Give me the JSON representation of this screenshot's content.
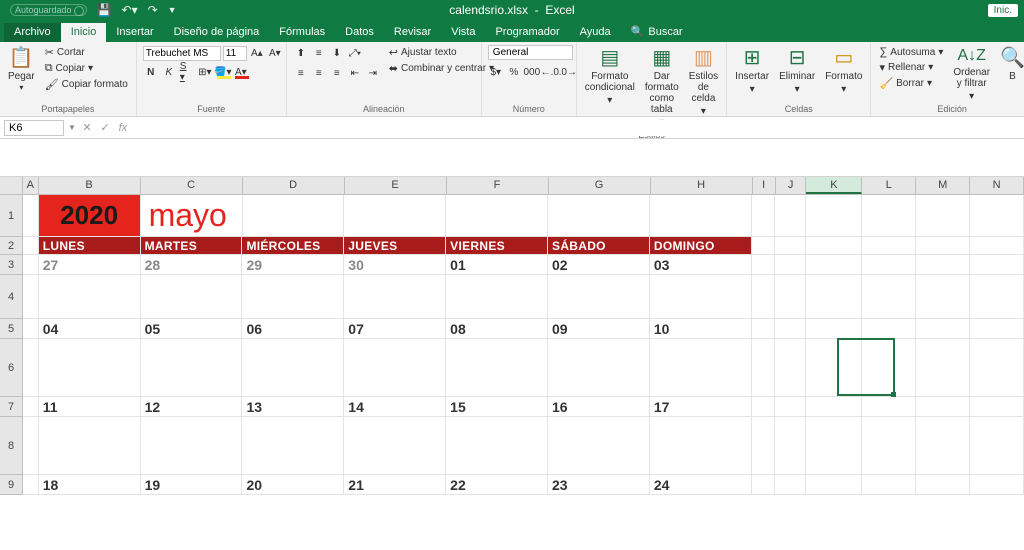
{
  "titlebar": {
    "autosave": "Autoguardado",
    "filename": "calendsrio.xlsx",
    "app": "Excel",
    "signin": "Inic."
  },
  "tabs": {
    "file": "Archivo",
    "home": "Inicio",
    "insert": "Insertar",
    "layout": "Diseño de página",
    "formulas": "Fórmulas",
    "data": "Datos",
    "review": "Revisar",
    "view": "Vista",
    "dev": "Programador",
    "help": "Ayuda",
    "tell": "Buscar"
  },
  "ribbon": {
    "clipboard": {
      "label": "Portapapeles",
      "paste": "Pegar",
      "cut": "Cortar",
      "copy": "Copiar",
      "format": "Copiar formato"
    },
    "font": {
      "label": "Fuente",
      "name": "Trebuchet MS",
      "size": "11"
    },
    "align": {
      "label": "Alineación",
      "wrap": "Ajustar texto",
      "merge": "Combinar y centrar"
    },
    "number": {
      "label": "Número",
      "format": "General"
    },
    "styles": {
      "label": "Estilos",
      "cond": "Formato condicional",
      "table": "Dar formato como tabla",
      "cell": "Estilos de celda"
    },
    "cells": {
      "label": "Celdas",
      "insert": "Insertar",
      "delete": "Eliminar",
      "format": "Formato"
    },
    "editing": {
      "label": "Edición",
      "sum": "Autosuma",
      "fill": "Rellenar",
      "clear": "Borrar",
      "sort": "Ordenar y filtrar",
      "find": "B"
    }
  },
  "namebox": "K6",
  "columns": [
    "A",
    "B",
    "C",
    "D",
    "E",
    "F",
    "G",
    "H",
    "I",
    "J",
    "K",
    "L",
    "M",
    "N"
  ],
  "calendar": {
    "year": "2020",
    "month": "mayo",
    "days": [
      "LUNES",
      "MARTES",
      "MIÉRCOLES",
      "JUEVES",
      "VIERNES",
      "SÁBADO",
      "DOMINGO"
    ],
    "weeks": [
      {
        "nums": [
          "27",
          "28",
          "29",
          "30",
          "01",
          "02",
          "03"
        ],
        "gray": [
          0,
          1,
          2,
          3
        ]
      },
      {
        "nums": [
          "04",
          "05",
          "06",
          "07",
          "08",
          "09",
          "10"
        ],
        "gray": []
      },
      {
        "nums": [
          "11",
          "12",
          "13",
          "14",
          "15",
          "16",
          "17"
        ],
        "gray": []
      },
      {
        "nums": [
          "18",
          "19",
          "20",
          "21",
          "22",
          "23",
          "24"
        ],
        "gray": []
      }
    ]
  },
  "chart_data": {
    "type": "table",
    "title": "mayo 2020",
    "columns": [
      "LUNES",
      "MARTES",
      "MIÉRCOLES",
      "JUEVES",
      "VIERNES",
      "SÁBADO",
      "DOMINGO"
    ],
    "rows": [
      [
        27,
        28,
        29,
        30,
        1,
        2,
        3
      ],
      [
        4,
        5,
        6,
        7,
        8,
        9,
        10
      ],
      [
        11,
        12,
        13,
        14,
        15,
        16,
        17
      ],
      [
        18,
        19,
        20,
        21,
        22,
        23,
        24
      ]
    ]
  },
  "selected_cell": "K6"
}
